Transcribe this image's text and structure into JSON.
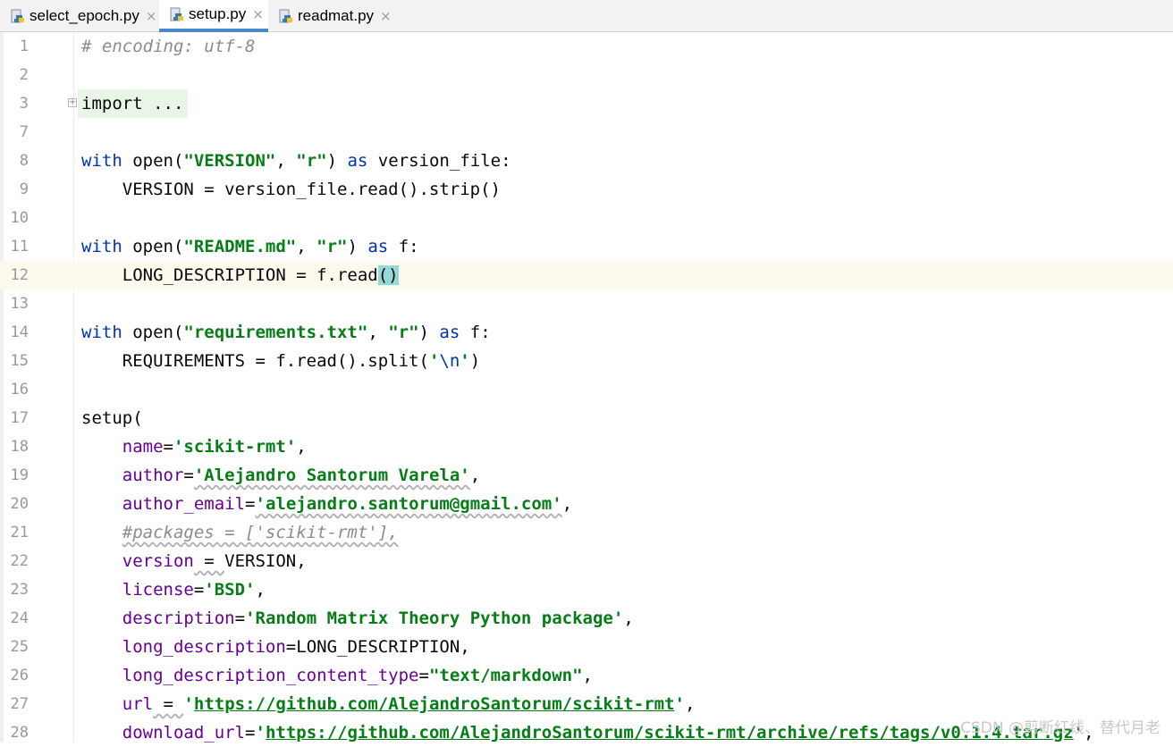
{
  "tabs": [
    {
      "label": "select_epoch.py",
      "active": false
    },
    {
      "label": "setup.py",
      "active": true
    },
    {
      "label": "readmat.py",
      "active": false
    }
  ],
  "close_glyph": "×",
  "fold_glyph": "+",
  "line_numbers": [
    "1",
    "2",
    "3",
    "7",
    "8",
    "9",
    "10",
    "11",
    "12",
    "13",
    "14",
    "15",
    "16",
    "17",
    "18",
    "19",
    "20",
    "21",
    "22",
    "23",
    "24",
    "25",
    "26",
    "27",
    "28"
  ],
  "code": {
    "l1": "# encoding: utf-8",
    "l3": "import ...",
    "l8": {
      "a": "with",
      "b": " open(",
      "c": "\"VERSION\"",
      "d": ", ",
      "e": "\"r\"",
      "f": ") ",
      "g": "as",
      "h": " version_file:"
    },
    "l9": "    VERSION = version_file.read().strip()",
    "l11": {
      "a": "with",
      "b": " open(",
      "c": "\"README.md\"",
      "d": ", ",
      "e": "\"r\"",
      "f": ") ",
      "g": "as",
      "h": " f:"
    },
    "l12": {
      "a": "    LONG_DESCRIPTION = f.read",
      "b": "()"
    },
    "l14": {
      "a": "with",
      "b": " open(",
      "c": "\"requirements.txt\"",
      "d": ", ",
      "e": "\"r\"",
      "f": ") ",
      "g": "as",
      "h": " f:"
    },
    "l15": {
      "a": "    REQUIREMENTS = f.read().split(",
      "b": "'",
      "c": "\\n",
      "d": "'",
      "e": ")"
    },
    "l17": "setup(",
    "l18": {
      "p": "name",
      "eq": "=",
      "v": "'scikit-rmt'",
      "t": ","
    },
    "l19": {
      "p": "author",
      "eq": "=",
      "v": "'Alejandro Santorum Varela'",
      "t": ","
    },
    "l20": {
      "p": "author_email",
      "eq": "=",
      "v": "'alejandro.santorum@gmail.com'",
      "t": ","
    },
    "l21": "#packages = ['scikit-rmt'],",
    "l22": {
      "p": "version",
      "eq": " = ",
      "v": "VERSION",
      "t": ","
    },
    "l23": {
      "p": "license",
      "eq": "=",
      "v": "'BSD'",
      "t": ","
    },
    "l24": {
      "p": "description",
      "eq": "=",
      "v": "'Random Matrix Theory Python package'",
      "t": ","
    },
    "l25": {
      "p": "long_description",
      "eq": "=",
      "v": "LONG_DESCRIPTION",
      "t": ","
    },
    "l26": {
      "p": "long_description_content_type",
      "eq": "=",
      "v": "\"text/markdown\"",
      "t": ","
    },
    "l27": {
      "p": "url",
      "eq": " = ",
      "q1": "'",
      "v": "https://github.com/AlejandroSantorum/scikit-rmt",
      "q2": "'",
      "t": ","
    },
    "l28": {
      "p": "download_url",
      "eq": "=",
      "q1": "'",
      "v": "https://github.com/AlejandroSantorum/scikit-rmt/archive/refs/tags/v0.1.4.tar.gz",
      "q2": "'",
      "t": ","
    }
  },
  "watermark": "CSDN @剪断红线、替代月老",
  "colors": {
    "keyword": "#0033b3",
    "string": "#067d17",
    "param": "#660099",
    "comment": "#8c8c8c",
    "tab_accent": "#4a88c7"
  }
}
